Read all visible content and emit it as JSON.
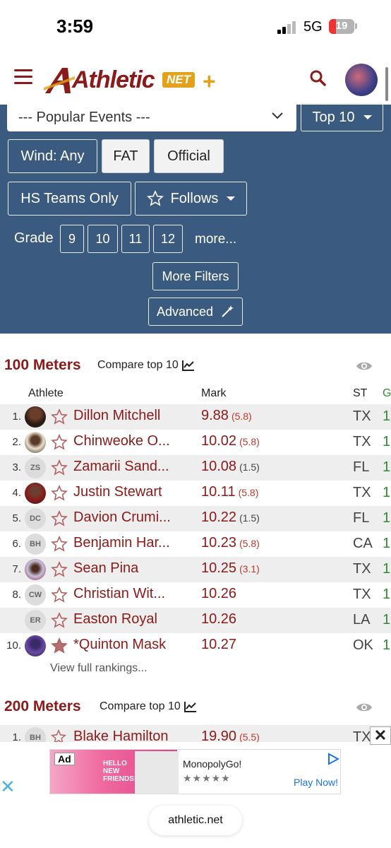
{
  "status": {
    "time": "3:59",
    "network": "5G",
    "battery": "19"
  },
  "header": {
    "logo_text": "Athletic",
    "logo_net": "NET",
    "logo_plus": "+"
  },
  "filters": {
    "event_select": "--- Popular Events ---",
    "top_select": "Top 10",
    "wind": "Wind: Any",
    "fat": "FAT",
    "official": "Official",
    "hs_teams": "HS Teams Only",
    "follows": "Follows",
    "grade_label": "Grade",
    "grades": [
      "9",
      "10",
      "11",
      "12"
    ],
    "more": "more...",
    "more_filters": "More Filters",
    "advanced": "Advanced"
  },
  "section1": {
    "title": "100 Meters",
    "compare": "Compare top 10",
    "columns": {
      "athlete": "Athlete",
      "mark": "Mark",
      "st": "ST",
      "gr": "G"
    },
    "rows": [
      {
        "rank": "1.",
        "avatar": "photo",
        "name": "Dillon Mitchell",
        "mark": "9.88",
        "wind": "(5.8)",
        "wind_color": "red",
        "st": "TX",
        "gr": "1"
      },
      {
        "rank": "2.",
        "avatar": "photo",
        "name": "Chinweoke O...",
        "mark": "10.02",
        "wind": "(5.8)",
        "wind_color": "red",
        "st": "TX",
        "gr": "1"
      },
      {
        "rank": "3.",
        "avatar": "ZS",
        "name": "Zamarii Sand...",
        "mark": "10.08",
        "wind": "(1.5)",
        "wind_color": "gray",
        "st": "FL",
        "gr": "1"
      },
      {
        "rank": "4.",
        "avatar": "photo",
        "name": "Justin Stewart",
        "mark": "10.11",
        "wind": "(5.8)",
        "wind_color": "red",
        "st": "TX",
        "gr": "1"
      },
      {
        "rank": "5.",
        "avatar": "DC",
        "name": "Davion Crumi...",
        "mark": "10.22",
        "wind": "(1.5)",
        "wind_color": "gray",
        "st": "FL",
        "gr": "1"
      },
      {
        "rank": "6.",
        "avatar": "BH",
        "name": "Benjamin Har...",
        "mark": "10.23",
        "wind": "(5.8)",
        "wind_color": "red",
        "st": "CA",
        "gr": "1"
      },
      {
        "rank": "7.",
        "avatar": "photo",
        "name": "Sean Pina",
        "mark": "10.25",
        "wind": "(3.1)",
        "wind_color": "red",
        "st": "TX",
        "gr": "1"
      },
      {
        "rank": "8.",
        "avatar": "CW",
        "name": "Christian Wit...",
        "mark": "10.26",
        "wind": "",
        "wind_color": "gray",
        "st": "TX",
        "gr": "1"
      },
      {
        "rank": "",
        "avatar": "ER",
        "name": "Easton Royal",
        "mark": "10.26",
        "wind": "",
        "wind_color": "gray",
        "st": "LA",
        "gr": "1"
      },
      {
        "rank": "10.",
        "avatar": "photo",
        "name": "*Quinton Mask",
        "mark": "10.27",
        "wind": "",
        "wind_color": "gray",
        "st": "OK",
        "gr": "1",
        "starred": true
      }
    ],
    "view_full": "View full rankings..."
  },
  "section2": {
    "title": "200 Meters",
    "compare": "Compare top 10",
    "first_row": {
      "rank": "1.",
      "avatar": "BH",
      "name": "Blake Hamilton",
      "mark": "19.90",
      "wind": "(5.5)",
      "st": "TX"
    }
  },
  "ad": {
    "tag": "Ad",
    "title": "MonopolyGo!",
    "stars": "★★★★★",
    "cta": "Play Now!",
    "image_text": "HELLO NEW FRIENDS!"
  },
  "url": "athletic.net",
  "colors": {
    "brand": "#8b1a1a",
    "panel": "#3b5a7f",
    "gold": "#e3a21a",
    "grade": "#2e8b2e"
  }
}
